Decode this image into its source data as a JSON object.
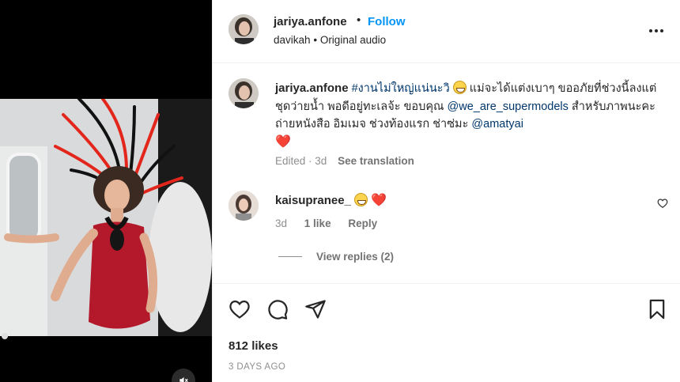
{
  "post": {
    "username": "jariya.anfone",
    "dot": "•",
    "follow_label": "Follow",
    "audio_user": "davikah",
    "audio_sep": "•",
    "audio_label": "Original audio"
  },
  "caption": {
    "username": "jariya.anfone",
    "part1": "#งานไม่ใหญ่แน่นะวิ",
    "part2": "แม่จะได้แต่งเบาๆ ขออภัยที่ช่วงนี้ลงแต่ชุดว่ายน้ำ พอดีอยู่ทะเลจ้ะ ขอบคุณ",
    "mention1": "@we_are_supermodels",
    "part3": "สำหรับภาพนะคะ ถ่ายหนังสือ อิมเมจ ช่วงท้องแรก ช่าซ่มะ",
    "mention2": "@amatyai",
    "heart": "❤️",
    "edited": "Edited · 3d",
    "see_translation": "See translation"
  },
  "comment": {
    "username": "kaisupranee_",
    "heart": "❤️",
    "age": "3d",
    "likes": "1 like",
    "reply": "Reply",
    "view_replies": "View replies (2)"
  },
  "actions": {
    "icons": [
      "heart-icon",
      "comment-icon",
      "share-icon",
      "bookmark-icon"
    ],
    "likes": "812 likes",
    "date": "3 DAYS AGO"
  },
  "colors": {
    "follow": "#0095f6",
    "link": "#00376b",
    "heart": "#e11d2e"
  }
}
